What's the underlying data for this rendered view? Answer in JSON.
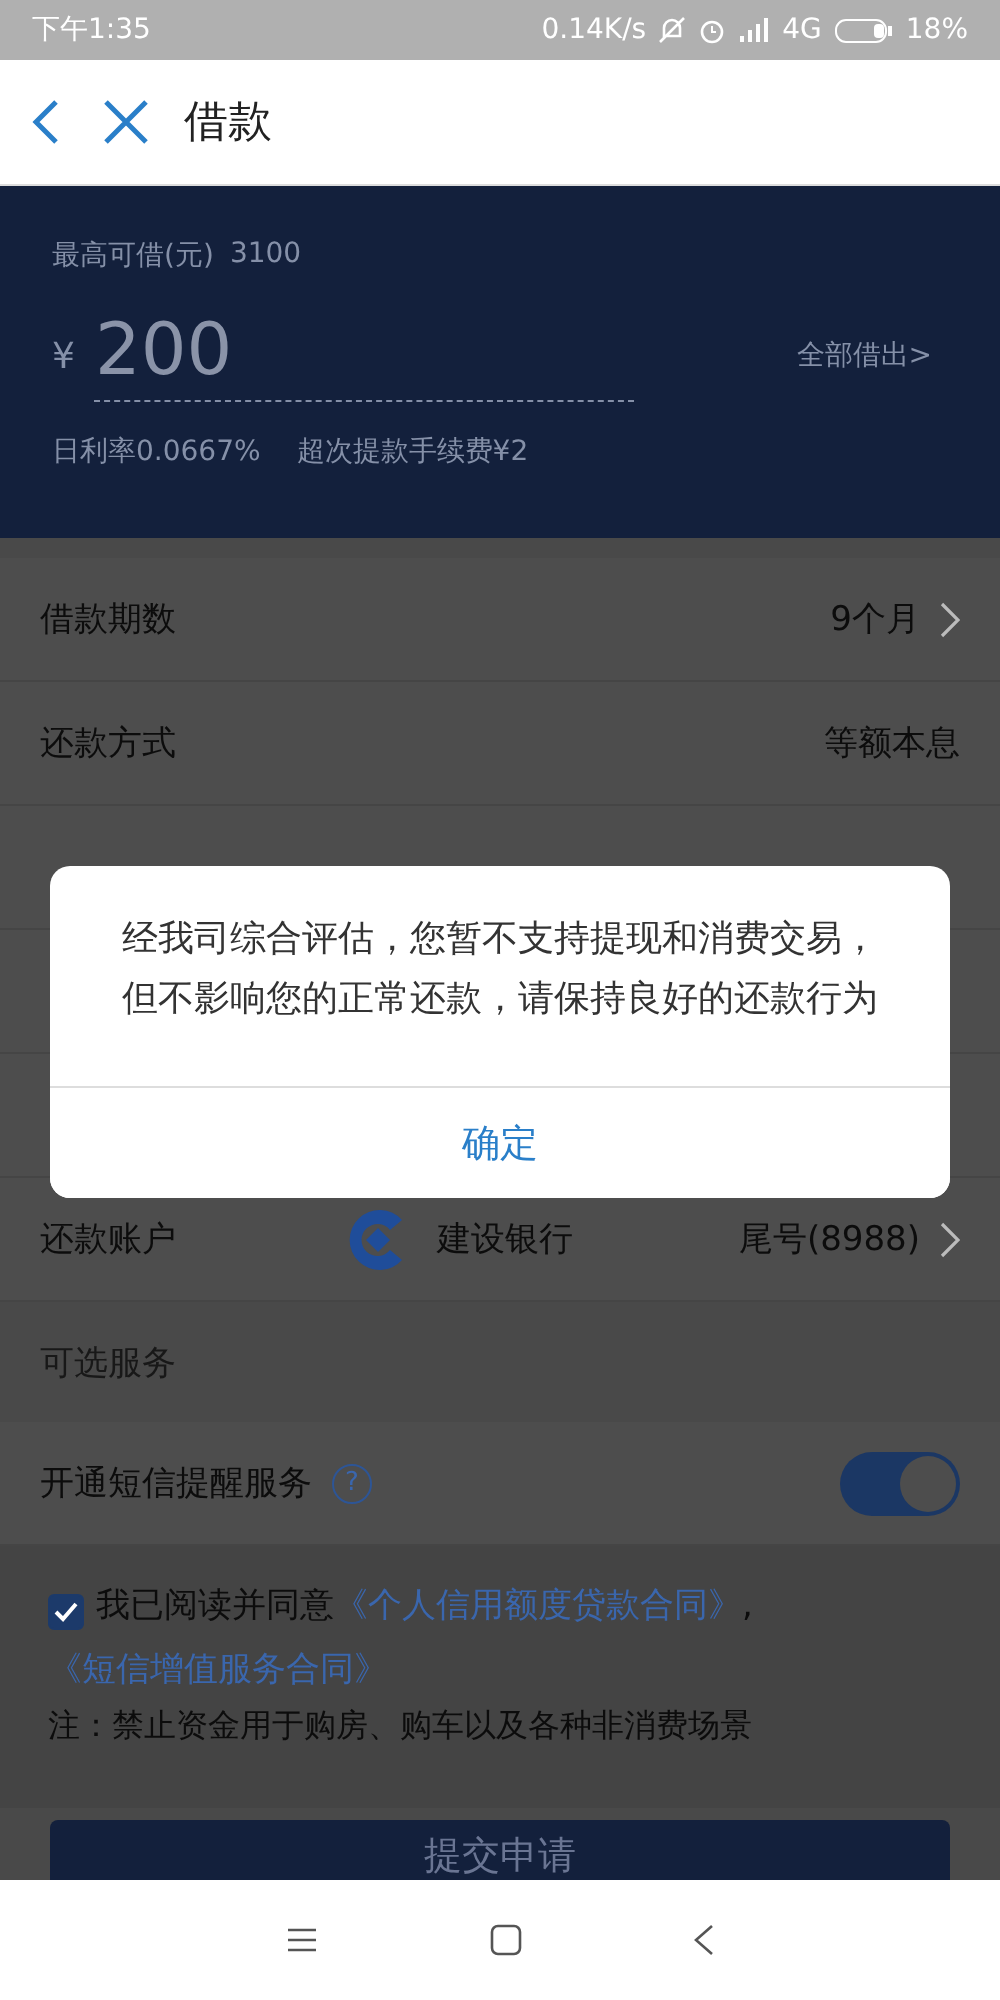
{
  "status_bar": {
    "time": "下午1:35",
    "net_speed": "0.14K/s",
    "network": "4G",
    "battery": "18%"
  },
  "header": {
    "title": "借款"
  },
  "loan": {
    "max_label": "最高可借(元)",
    "max_value": "3100",
    "currency": "¥",
    "amount": "200",
    "borrow_all": "全部借出>",
    "rate": "日利率0.0667%",
    "fee": "超次提款手续费¥2"
  },
  "rows": [
    {
      "label": "借款期数",
      "value": "9个月",
      "chevron": true
    },
    {
      "label": "还款方式",
      "value": "等额本息",
      "chevron": false
    }
  ],
  "account": {
    "label": "还款账户",
    "bank": "建设银行",
    "tail": "尾号(8988)"
  },
  "optional": {
    "section": "可选服务",
    "sms_label": "开通短信提醒服务",
    "sms_on": true,
    "help": "?"
  },
  "agreement": {
    "checked": true,
    "text": "我已阅读并同意",
    "links": [
      "《个人信用额度贷款合同》",
      "《短信增值服务合同》"
    ],
    "separator": ","
  },
  "note": "注：禁止资金用于购房、购车以及各种非消费场景",
  "submit": "提交申请",
  "dialog": {
    "message": "经我司综合评估，您暂不支持提现和消费交易，但不影响您的正常还款，请保持良好的还款行为",
    "button": "确定"
  }
}
